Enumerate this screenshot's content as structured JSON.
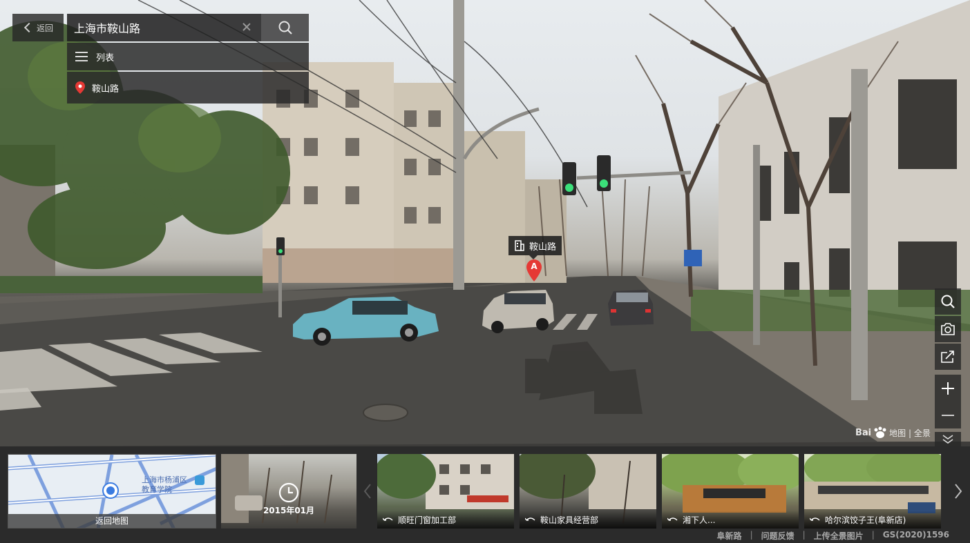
{
  "top": {
    "back_label": "返回",
    "search_value": "上海市鞍山路",
    "list_label": "列表",
    "result_label": "鞍山路"
  },
  "poi": {
    "label": "鞍山路",
    "marker_letter": "A"
  },
  "watermark": {
    "brand": "Bai",
    "product": "地图 | 全景"
  },
  "minimap": {
    "caption": "返回地图",
    "place_label_line1": "上海市杨浦区",
    "place_label_line2": "教育学院"
  },
  "timecard": {
    "date": "2015年01月"
  },
  "thumbnails": [
    {
      "label": "顺旺门窗加工部"
    },
    {
      "label": "鞍山家具经营部"
    },
    {
      "label": "湘下人..."
    },
    {
      "label": "哈尔滨饺子王(阜新店)"
    }
  ],
  "footer": {
    "road": "阜新路",
    "feedback": "问题反馈",
    "upload": "上传全景图片",
    "license": "GS(2020)1596"
  },
  "colors": {
    "marker_red": "#e53935",
    "panel_bg": "#2b2b2b",
    "minimap_road": "#6b8fd6"
  }
}
